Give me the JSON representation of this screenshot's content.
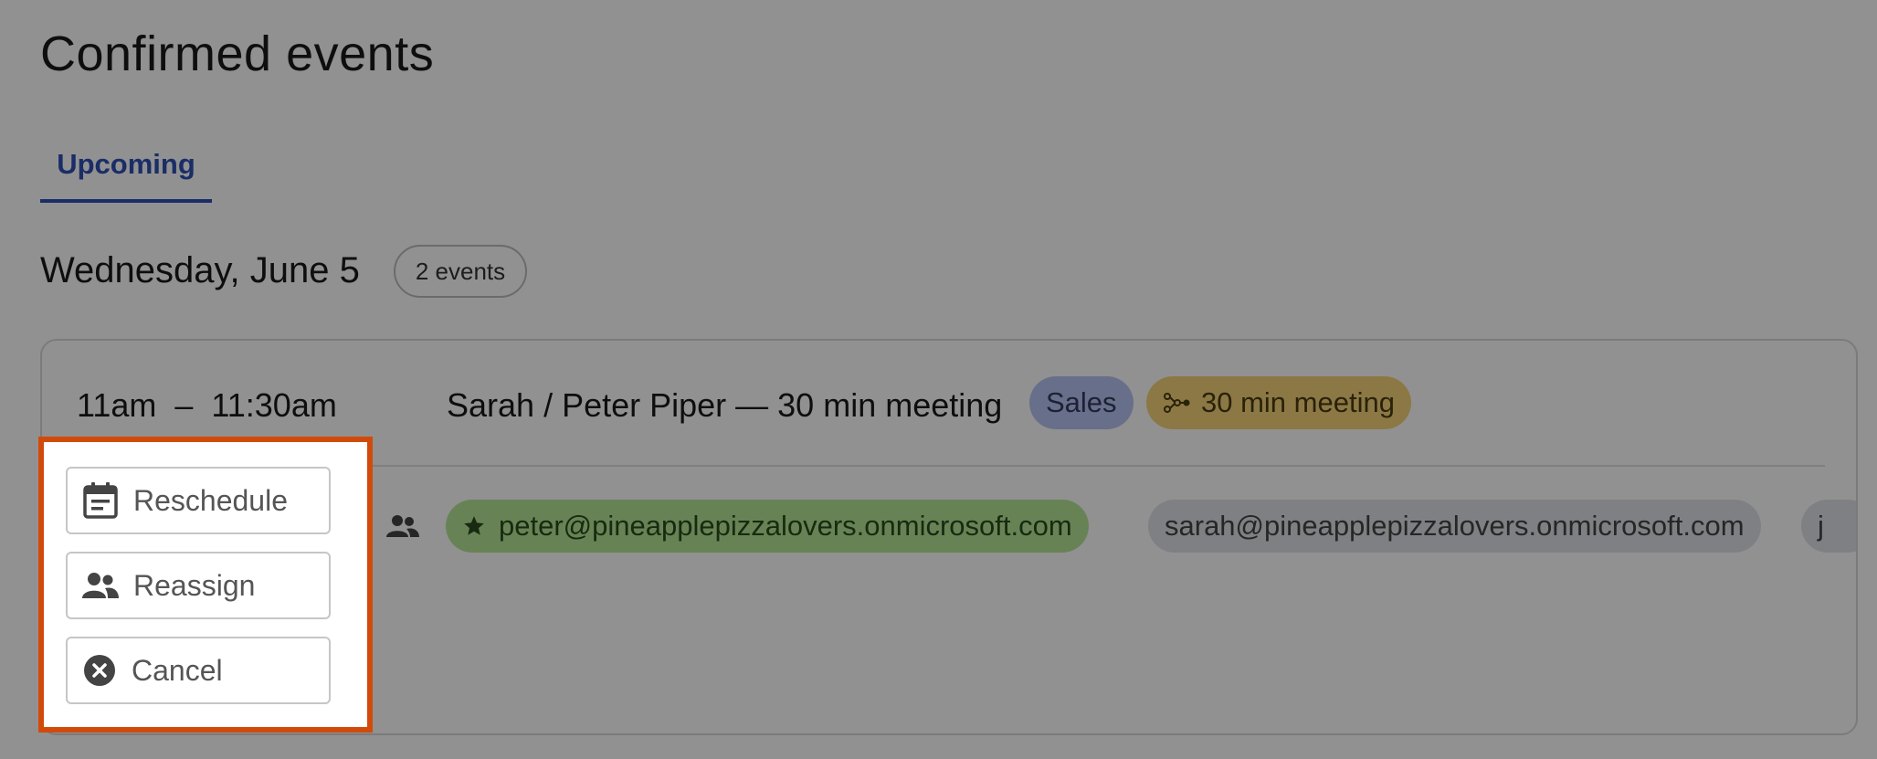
{
  "page": {
    "title": "Confirmed events"
  },
  "tabs": [
    {
      "label": "Upcoming",
      "active": true
    }
  ],
  "day": {
    "heading": "Wednesday, June 5",
    "count_badge": "2 events"
  },
  "event": {
    "time": "11am  –  11:30am",
    "title": "Sarah / Peter Piper — 30 min meeting",
    "tags": [
      {
        "label": "Sales",
        "color": "#b8c4f2"
      },
      {
        "label": "30 min meeting",
        "icon": "workflow-icon",
        "color": "#f7d47a"
      }
    ],
    "attendees": [
      {
        "email": "peter@pineapplepizzalovers.onmicrosoft.com",
        "host": true,
        "icon": "star-icon",
        "color": "#b5e698"
      },
      {
        "email": "sarah@pineapplepizzalovers.onmicrosoft.com",
        "host": false,
        "color": "#dfe1e6"
      },
      {
        "email": "j",
        "host": false,
        "color": "#dfe1e6"
      }
    ]
  },
  "actions": [
    {
      "label": "Reschedule",
      "icon": "calendar-icon"
    },
    {
      "label": "Reassign",
      "icon": "people-icon"
    },
    {
      "label": "Cancel",
      "icon": "cancel-circle-icon"
    }
  ],
  "colors": {
    "accent": "#2f4fb5",
    "highlight_border": "#d24a0a",
    "overlay": "rgba(0,0,0,0.43)"
  }
}
